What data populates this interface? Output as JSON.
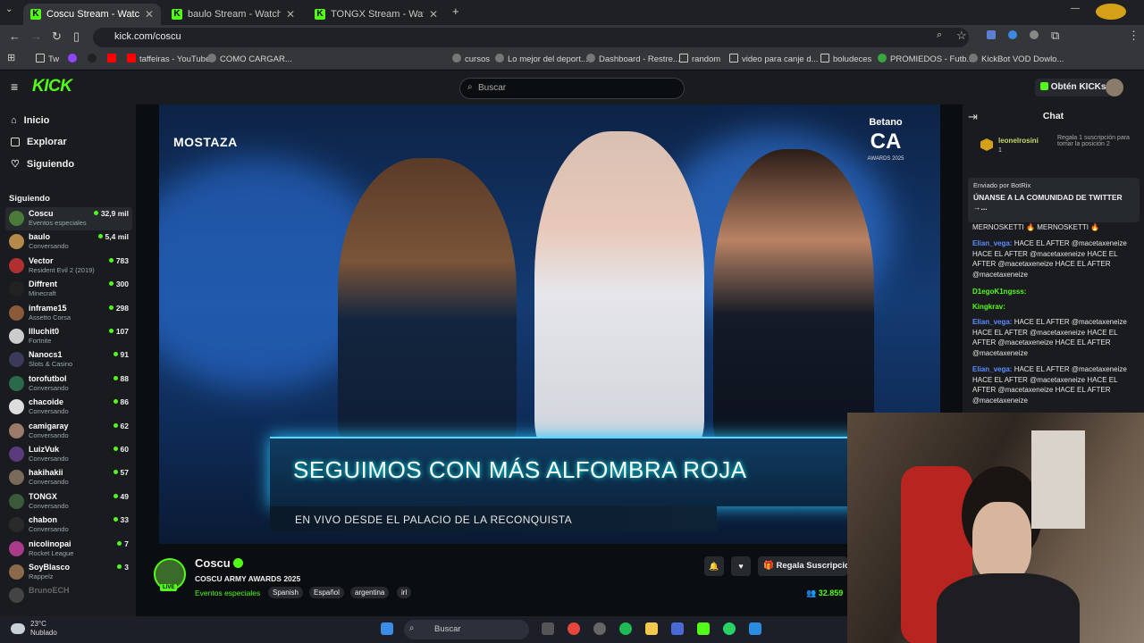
{
  "browser": {
    "tabs": [
      {
        "title": "Coscu Stream - Watch Live o",
        "active": true
      },
      {
        "title": "baulo Stream - Watch Live on K",
        "active": false
      },
      {
        "title": "TONGX Stream - Watch Live on",
        "active": false
      }
    ],
    "url": "kick.com/coscu",
    "bookmarks": [
      "Tw",
      "taffeiras - YouTube",
      "COMO CARGAR...",
      "cursos",
      "Lo mejor del deport...",
      "Dashboard - Restre...",
      "random",
      "video para canje d...",
      "boludeces",
      "PROMIEDOS - Futb...",
      "KickBot VOD Dowlo..."
    ]
  },
  "header": {
    "logo": "KICK",
    "search_placeholder": "Buscar",
    "kicks_label": "Obtén KICKs"
  },
  "sidebar": {
    "nav": [
      "Inicio",
      "Explorar",
      "Siguiendo"
    ],
    "following_title": "Siguiendo",
    "following": [
      {
        "name": "Coscu",
        "category": "Eventos especiales",
        "viewers": "32,9 mil",
        "color": "#4a7a3a"
      },
      {
        "name": "baulo",
        "category": "Conversando",
        "viewers": "5,4 mil",
        "color": "#b5894a"
      },
      {
        "name": "Vector",
        "category": "Resident Evil 2 (2019)",
        "viewers": "783",
        "color": "#b03030"
      },
      {
        "name": "Diffrent",
        "category": "Minecraft",
        "viewers": "300",
        "color": "#222222"
      },
      {
        "name": "inframe15",
        "category": "Assetto Corsa",
        "viewers": "298",
        "color": "#8a5a3a"
      },
      {
        "name": "Illuchit0",
        "category": "Fortnite",
        "viewers": "107",
        "color": "#cccccc"
      },
      {
        "name": "Nanocs1",
        "category": "Slots & Casino",
        "viewers": "91",
        "color": "#3a3a5a"
      },
      {
        "name": "torofutbol",
        "category": "Conversando",
        "viewers": "88",
        "color": "#2a6a4a"
      },
      {
        "name": "chacoide",
        "category": "Conversando",
        "viewers": "86",
        "color": "#dddddd"
      },
      {
        "name": "camigaray",
        "category": "Conversando",
        "viewers": "62",
        "color": "#9a7a6a"
      },
      {
        "name": "LuizVuk",
        "category": "Conversando",
        "viewers": "60",
        "color": "#5a3a7a"
      },
      {
        "name": "hakihakii",
        "category": "Conversando",
        "viewers": "57",
        "color": "#7a6a5a"
      },
      {
        "name": "TONGX",
        "category": "Conversando",
        "viewers": "49",
        "color": "#3a5a3a"
      },
      {
        "name": "chabon",
        "category": "Conversando",
        "viewers": "33",
        "color": "#2a2a2a"
      },
      {
        "name": "nicolinopai",
        "category": "Rocket League",
        "viewers": "7",
        "color": "#aa3a8a"
      },
      {
        "name": "SoyBlasco",
        "category": "Rappelz",
        "viewers": "3",
        "color": "#8a6a4a"
      },
      {
        "name": "BrunoECH",
        "category": "",
        "viewers": "",
        "color": "#444444"
      }
    ]
  },
  "video": {
    "sponsor_left": "MOSTAZA",
    "sponsor_right": "Betano",
    "logo_big": "CA",
    "logo_sub": "AWARDS 2025",
    "banner_title": "SEGUIMOS CON MÁS ALFOMBRA ROJA",
    "banner_sub": "EN VIVO DESDE EL PALACIO DE LA RECONQUISTA"
  },
  "stream": {
    "channel": "Coscu",
    "live": "LIVE",
    "title": "COSCU ARMY AWARDS 2025",
    "category": "Eventos especiales",
    "tags": [
      "Spanish",
      "Español",
      "argentina",
      "irl"
    ],
    "subscribe_label": "Regala Suscripcio",
    "viewers": "32.859"
  },
  "chat": {
    "title": "Chat",
    "gifter": "leonelrosini",
    "gifter_count": "1",
    "gift_note": "Regala 1 suscripción para tomar la posición 2",
    "pinned_by": "Enviado por BotRix",
    "pinned_msg": "ÚNANSE A LA COMUNIDAD DE TWITTER →...",
    "messages": [
      {
        "user": "",
        "text": "MERNOSKETTI 🔥 MERNOSKETTI 🔥",
        "color": "#efeff1"
      },
      {
        "user": "Elian_vega:",
        "text": " HACE EL AFTER @macetaxeneize HACE EL AFTER @macetaxeneize HACE EL AFTER @macetaxeneize HACE EL AFTER @macetaxeneize",
        "color": "#5b8cff"
      },
      {
        "user": "D1egoK1ngsss:",
        "text": "",
        "color": "#53fc18"
      },
      {
        "user": "Kingkrav:",
        "text": "",
        "color": "#53fc18"
      },
      {
        "user": "Elian_vega:",
        "text": " HACE EL AFTER @macetaxeneize HACE EL AFTER @macetaxeneize HACE EL AFTER @macetaxeneize HACE EL AFTER @macetaxeneize",
        "color": "#5b8cff"
      },
      {
        "user": "Elian_vega:",
        "text": " HACE EL AFTER @macetaxeneize HACE EL AFTER @macetaxeneize HACE EL AFTER @macetaxeneize HACE EL AFTER @macetaxeneize",
        "color": "#5b8cff"
      }
    ]
  },
  "taskbar": {
    "temp": "23°C",
    "weather": "Nublado",
    "search": "Buscar"
  }
}
